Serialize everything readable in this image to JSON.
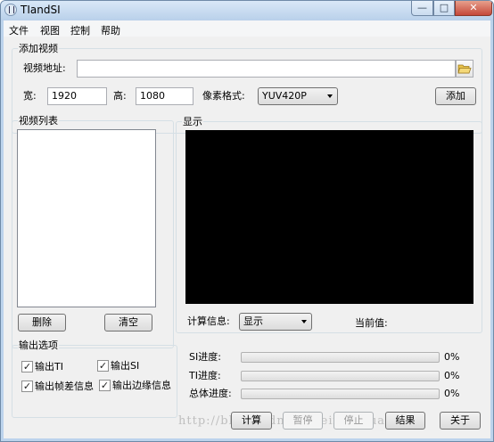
{
  "window": {
    "title": "TIandSI",
    "min_symbol": "—",
    "max_symbol": "□",
    "close_symbol": "✕"
  },
  "menu": [
    "文件",
    "视图",
    "控制",
    "帮助"
  ],
  "add_video": {
    "group_label": "添加视频",
    "address_label": "视频地址:",
    "address_value": "",
    "width_label": "宽:",
    "width_value": "1920",
    "height_label": "高:",
    "height_value": "1080",
    "pixel_format_label": "像素格式:",
    "pixel_format_value": "YUV420P",
    "add_button": "添加",
    "folder_icon": "folder-open-icon"
  },
  "video_list": {
    "group_label": "视频列表",
    "delete_button": "删除",
    "clear_button": "清空"
  },
  "display": {
    "group_label": "显示",
    "calc_info_label": "计算信息:",
    "calc_info_value": "显示",
    "current_value_label": "当前值:",
    "background_color": "#000000"
  },
  "output_options": {
    "group_label": "输出选项",
    "checkboxes": [
      {
        "label": "输出TI",
        "checked": true
      },
      {
        "label": "输出SI",
        "checked": true
      },
      {
        "label": "输出帧差信息",
        "checked": true
      },
      {
        "label": "输出边缘信息",
        "checked": true
      }
    ],
    "check_mark": "✓"
  },
  "progress": [
    {
      "label": "SI进度:",
      "value": 0,
      "text": "0%"
    },
    {
      "label": "TI进度:",
      "value": 0,
      "text": "0%"
    },
    {
      "label": "总体进度:",
      "value": 0,
      "text": "0%"
    }
  ],
  "actions": {
    "compute": "计算",
    "pause": "暂停",
    "stop": "停止",
    "result": "结果",
    "about": "关于"
  },
  "watermark": "http://blog.csdn.net/leixiaohua1020"
}
